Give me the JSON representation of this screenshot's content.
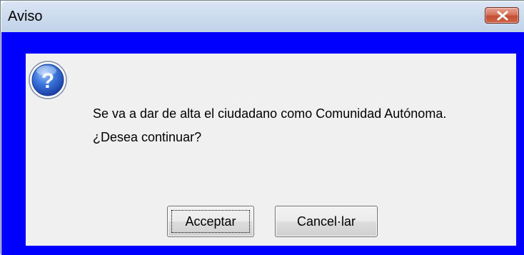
{
  "window": {
    "title": "Aviso",
    "close_icon": "close-icon"
  },
  "dialog": {
    "icon": "question-icon",
    "message_line1": "Se va a dar de alta el ciudadano como Comunidad Autónoma.",
    "message_line2": "¿Desea continuar?",
    "accept_label": "Acceptar",
    "cancel_label": "Cancel·lar"
  },
  "colors": {
    "frame": "#0000ff",
    "titlebar": "#cddcee",
    "content_bg": "#f0f0f0",
    "close_button": "#c24e33"
  }
}
